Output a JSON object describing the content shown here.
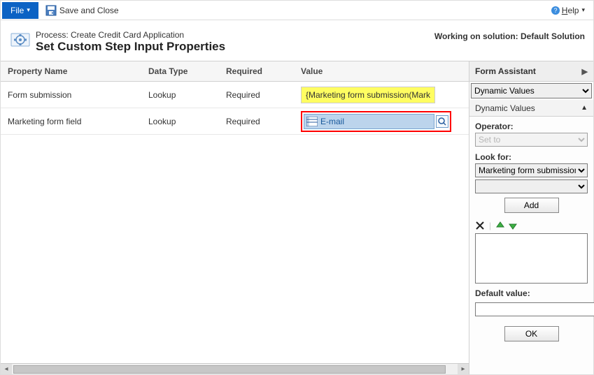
{
  "toolbar": {
    "file": "File",
    "save_close": "Save and Close",
    "help": "Help"
  },
  "header": {
    "process_line": "Process: Create Credit Card Application",
    "title": "Set Custom Step Input Properties",
    "working_on": "Working on solution: Default Solution"
  },
  "table": {
    "columns": {
      "name": "Property Name",
      "type": "Data Type",
      "required": "Required",
      "value": "Value"
    },
    "rows": [
      {
        "name": "Form submission",
        "type": "Lookup",
        "required": "Required",
        "value_text": "{Marketing form submission(Mark",
        "kind": "expr"
      },
      {
        "name": "Marketing form field",
        "type": "Lookup",
        "required": "Required",
        "value_text": "E-mail",
        "kind": "lookup"
      }
    ]
  },
  "assistant": {
    "title": "Form Assistant",
    "mode_select": "Dynamic Values",
    "sub_header": "Dynamic Values",
    "operator_label": "Operator:",
    "operator_value": "Set to",
    "lookfor_label": "Look for:",
    "lookfor_value": "Marketing form submission",
    "lookfor_value2": "",
    "add_label": "Add",
    "default_label": "Default value:",
    "default_value": "",
    "ok_label": "OK"
  }
}
